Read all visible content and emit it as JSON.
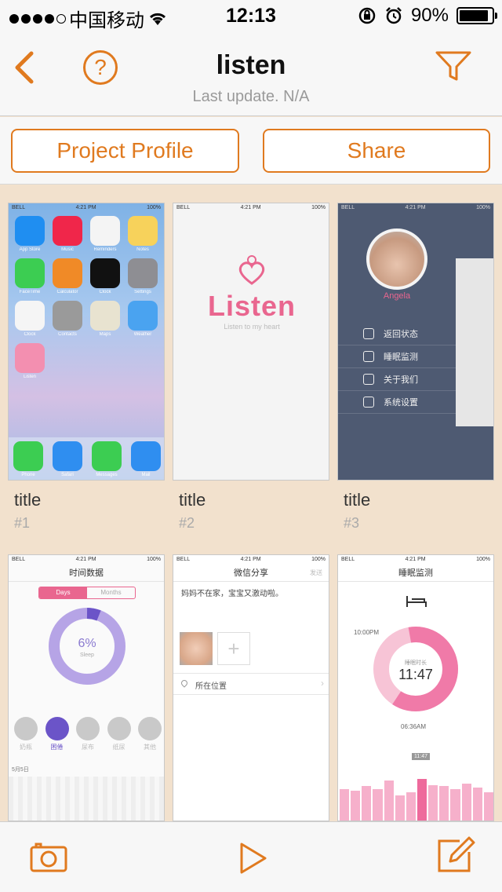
{
  "status_bar": {
    "carrier": "中国移动",
    "time": "12:13",
    "battery_percent": "90%",
    "battery_level": 0.9
  },
  "nav": {
    "title": "listen",
    "subtitle": "Last update. N/A"
  },
  "buttons": {
    "project_profile": "Project Profile",
    "share": "Share"
  },
  "screens": [
    {
      "title": "title",
      "number": "#1"
    },
    {
      "title": "title",
      "number": "#2"
    },
    {
      "title": "title",
      "number": "#3"
    },
    {
      "title": "",
      "number": ""
    },
    {
      "title": "",
      "number": ""
    },
    {
      "title": "",
      "number": ""
    }
  ],
  "shot1": {
    "apps": [
      "App Store",
      "Music",
      "Reminders",
      "Notes",
      "FaceTime",
      "Calculator",
      "Clock",
      "Settings",
      "Clock",
      "Contacts",
      "Maps",
      "Weather",
      "Listen"
    ],
    "dock": [
      "Phone",
      "Safari",
      "Messages",
      "Mail"
    ]
  },
  "shot2": {
    "logo": "Listen",
    "tagline": "Listen to my heart"
  },
  "shot3": {
    "profile_name": "Angela",
    "menu": [
      "返回状态",
      "睡眠监测",
      "关于我们",
      "系统设置"
    ]
  },
  "shot4": {
    "header": "时间数据",
    "tabs": [
      "Days",
      "Months"
    ],
    "percent": "6%",
    "percent_label": "Sleep",
    "icons": [
      "奶瓶",
      "困倦",
      "尿布",
      "纸尿",
      "其他"
    ],
    "date": "5月5日"
  },
  "shot5": {
    "header": "微信分享",
    "action": "发送",
    "text": "妈妈不在家，宝宝又激动啦。",
    "location": "所在位置"
  },
  "shot6": {
    "header": "睡眠监测",
    "time": "11:47",
    "time_label": "睡眠时长",
    "label_top": "10:00PM",
    "label_bottom": "06:36AM",
    "bar_tag": "11:47",
    "bars": [
      0.55,
      0.52,
      0.6,
      0.55,
      0.7,
      0.45,
      0.5,
      0.72,
      0.62,
      0.6,
      0.55,
      0.65,
      0.58,
      0.5
    ]
  },
  "colors": {
    "accent": "#e07a1f",
    "background": "#f2e1cd",
    "pink": "#f07aa8"
  },
  "mini_time": "4:21 PM",
  "mini_carrier": "BELL",
  "mini_battery": "100%"
}
